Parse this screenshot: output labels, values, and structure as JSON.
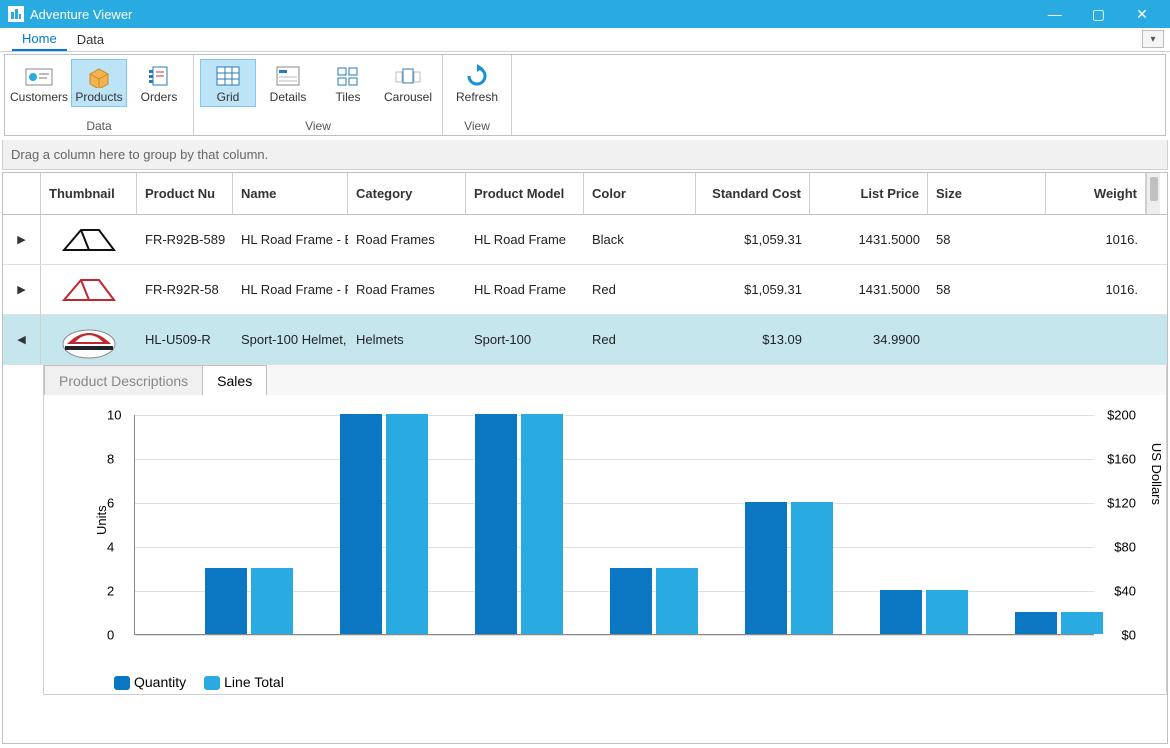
{
  "window": {
    "title": "Adventure Viewer"
  },
  "main_tabs": [
    "Home",
    "Data"
  ],
  "ribbon": {
    "groups": [
      {
        "label": "Data",
        "items": [
          "Customers",
          "Products",
          "Orders"
        ],
        "selected": "Products"
      },
      {
        "label": "View",
        "items": [
          "Grid",
          "Details",
          "Tiles",
          "Carousel"
        ],
        "selected": "Grid"
      },
      {
        "label": "View",
        "items": [
          "Refresh"
        ]
      }
    ]
  },
  "group_hint": "Drag a column here to group by that column.",
  "columns": [
    "Thumbnail",
    "Product Nu",
    "Name",
    "Category",
    "Product Model",
    "Color",
    "Standard Cost",
    "List Price",
    "Size",
    "Weight"
  ],
  "rows": [
    {
      "expander": "▶",
      "thumb": "frame-black",
      "pnum": "FR-R92B-589",
      "name": "HL Road Frame - B",
      "cat": "Road Frames",
      "model": "HL Road Frame",
      "color": "Black",
      "cost": "$1,059.31",
      "list": "1431.5000",
      "size": "58",
      "weight": "1016."
    },
    {
      "expander": "▶",
      "thumb": "frame-red",
      "pnum": "FR-R92R-58",
      "name": "HL Road Frame - R",
      "cat": "Road Frames",
      "model": "HL Road Frame",
      "color": "Red",
      "cost": "$1,059.31",
      "list": "1431.5000",
      "size": "58",
      "weight": "1016."
    },
    {
      "expander": "◀",
      "thumb": "helmet",
      "pnum": "HL-U509-R",
      "name": "Sport-100 Helmet,",
      "cat": "Helmets",
      "model": "Sport-100",
      "color": "Red",
      "cost": "$13.09",
      "list": "34.9900",
      "size": "",
      "weight": "",
      "selected": true
    }
  ],
  "detail_tabs": [
    "Product Descriptions",
    "Sales"
  ],
  "detail_tab_active": "Sales",
  "chart_data": {
    "type": "bar",
    "y_left_label": "Units",
    "y_right_label": "US Dollars",
    "y_left_ticks": [
      0,
      2,
      4,
      6,
      8,
      10
    ],
    "y_right_ticks": [
      "$0",
      "$40",
      "$80",
      "$120",
      "$160",
      "$200"
    ],
    "series": [
      {
        "name": "Quantity",
        "values": [
          3,
          10,
          10,
          3,
          6,
          2,
          1
        ]
      },
      {
        "name": "Line Total",
        "values": [
          3,
          10,
          10,
          3,
          6,
          2,
          1
        ]
      }
    ],
    "legend": [
      "Quantity",
      "Line Total"
    ]
  }
}
